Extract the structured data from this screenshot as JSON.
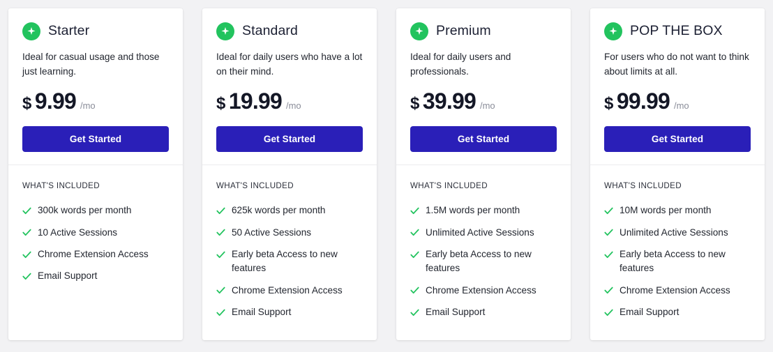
{
  "page": {
    "background_color": "#f2f2f4",
    "accent_color": "#2a1fb8",
    "badge_color": "#22c35e",
    "check_color": "#22c35e"
  },
  "plans": [
    {
      "badge_icon": "sparkle-icon",
      "name": "Starter",
      "description": "Ideal for casual usage and those just learning.",
      "currency": "$",
      "amount": "9.99",
      "period": "/mo",
      "cta_label": "Get Started",
      "included_label": "WHAT'S INCLUDED",
      "features": [
        "300k words per month",
        "10 Active Sessions",
        "Chrome Extension Access",
        "Email Support"
      ]
    },
    {
      "badge_icon": "sparkle-icon",
      "name": "Standard",
      "description": "Ideal for daily users who have a lot on their mind.",
      "currency": "$",
      "amount": "19.99",
      "period": "/mo",
      "cta_label": "Get Started",
      "included_label": "WHAT'S INCLUDED",
      "features": [
        "625k words per month",
        "50 Active Sessions",
        "Early beta Access to new features",
        "Chrome Extension Access",
        "Email Support"
      ]
    },
    {
      "badge_icon": "sparkle-icon",
      "name": "Premium",
      "description": "Ideal for daily users and professionals.",
      "currency": "$",
      "amount": "39.99",
      "period": "/mo",
      "cta_label": "Get Started",
      "included_label": "WHAT'S INCLUDED",
      "features": [
        "1.5M words per month",
        "Unlimited Active Sessions",
        "Early beta Access to new features",
        "Chrome Extension Access",
        "Email Support"
      ]
    },
    {
      "badge_icon": "sparkle-icon",
      "name": "POP THE BOX",
      "description": "For users who do not want to think about limits at all.",
      "currency": "$",
      "amount": "99.99",
      "period": "/mo",
      "cta_label": "Get Started",
      "included_label": "WHAT'S INCLUDED",
      "features": [
        "10M words per month",
        "Unlimited Active Sessions",
        "Early beta Access to new features",
        "Chrome Extension Access",
        "Email Support"
      ]
    }
  ]
}
